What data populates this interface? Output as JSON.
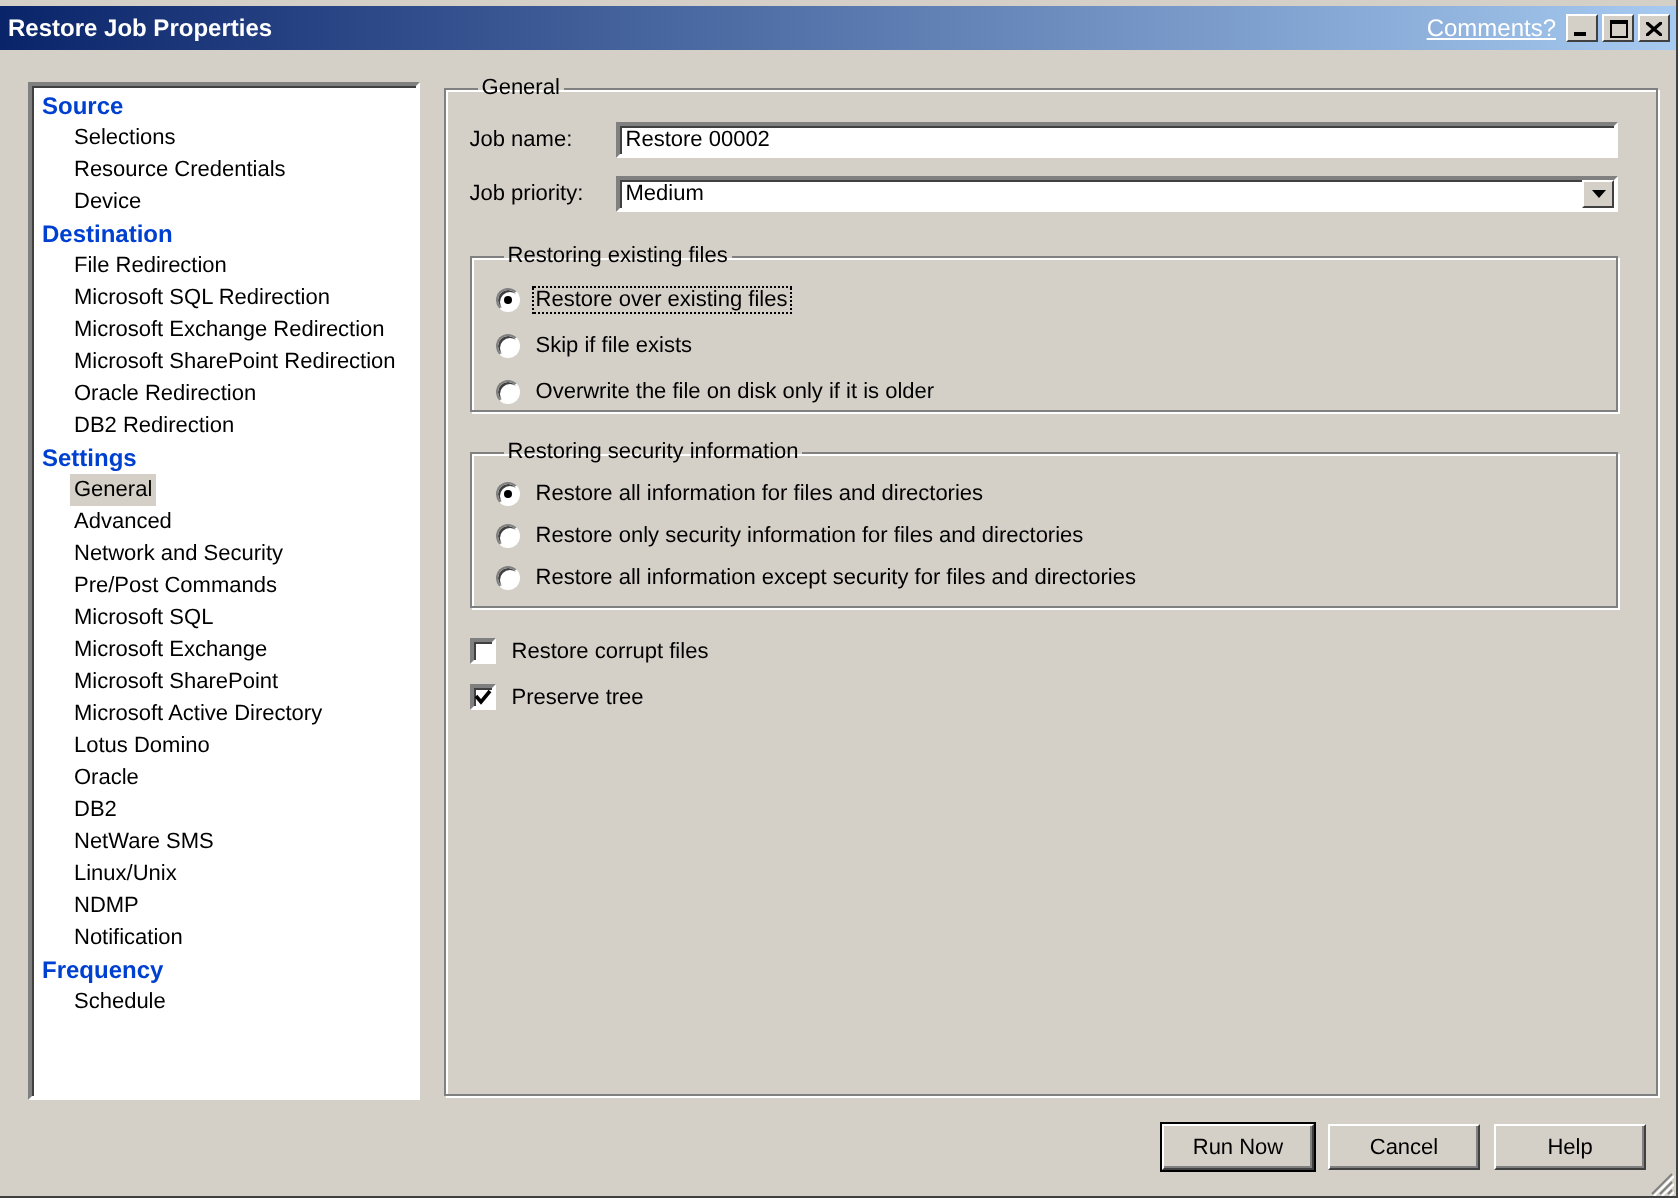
{
  "window": {
    "title": "Restore Job Properties",
    "help_link": "Comments?"
  },
  "sidebar": {
    "sections": [
      {
        "title": "Source",
        "items": [
          {
            "label": "Selections",
            "selected": false
          },
          {
            "label": "Resource Credentials",
            "selected": false
          },
          {
            "label": "Device",
            "selected": false
          }
        ]
      },
      {
        "title": "Destination",
        "items": [
          {
            "label": "File Redirection",
            "selected": false
          },
          {
            "label": "Microsoft SQL Redirection",
            "selected": false
          },
          {
            "label": "Microsoft Exchange Redirection",
            "selected": false
          },
          {
            "label": "Microsoft SharePoint Redirection",
            "selected": false
          },
          {
            "label": "Oracle Redirection",
            "selected": false
          },
          {
            "label": "DB2 Redirection",
            "selected": false
          }
        ]
      },
      {
        "title": "Settings",
        "items": [
          {
            "label": "General",
            "selected": true
          },
          {
            "label": "Advanced",
            "selected": false
          },
          {
            "label": "Network and Security",
            "selected": false
          },
          {
            "label": "Pre/Post Commands",
            "selected": false
          },
          {
            "label": "Microsoft SQL",
            "selected": false
          },
          {
            "label": "Microsoft Exchange",
            "selected": false
          },
          {
            "label": "Microsoft SharePoint",
            "selected": false
          },
          {
            "label": "Microsoft Active Directory",
            "selected": false
          },
          {
            "label": "Lotus Domino",
            "selected": false
          },
          {
            "label": "Oracle",
            "selected": false
          },
          {
            "label": "DB2",
            "selected": false
          },
          {
            "label": "NetWare SMS",
            "selected": false
          },
          {
            "label": "Linux/Unix",
            "selected": false
          },
          {
            "label": "NDMP",
            "selected": false
          },
          {
            "label": "Notification",
            "selected": false
          }
        ]
      },
      {
        "title": "Frequency",
        "items": [
          {
            "label": "Schedule",
            "selected": false
          }
        ]
      }
    ]
  },
  "general": {
    "title": "General",
    "job_name": {
      "label": "Job name:",
      "value": "Restore 00002"
    },
    "job_priority": {
      "label": "Job priority:",
      "value": "Medium"
    },
    "radio_groups": [
      {
        "title": "Restoring existing files",
        "options": [
          {
            "label": "Restore over existing files",
            "selected": true,
            "focused": true
          },
          {
            "label": "Skip if file exists",
            "selected": false,
            "focused": false
          },
          {
            "label": "Overwrite the file on disk only if it is older",
            "selected": false,
            "focused": false
          }
        ]
      },
      {
        "title": "Restoring security information",
        "options": [
          {
            "label": "Restore all information for files and directories",
            "selected": true,
            "focused": false
          },
          {
            "label": "Restore only security information for files and directories",
            "selected": false,
            "focused": false
          },
          {
            "label": "Restore all information except security for files and directories",
            "selected": false,
            "focused": false
          }
        ]
      }
    ],
    "checkboxes": [
      {
        "label": "Restore corrupt files",
        "checked": false
      },
      {
        "label": "Preserve tree",
        "checked": true
      }
    ]
  },
  "buttons": [
    {
      "label": "Run Now",
      "default": true
    },
    {
      "label": "Cancel",
      "default": false
    },
    {
      "label": "Help",
      "default": false
    }
  ]
}
